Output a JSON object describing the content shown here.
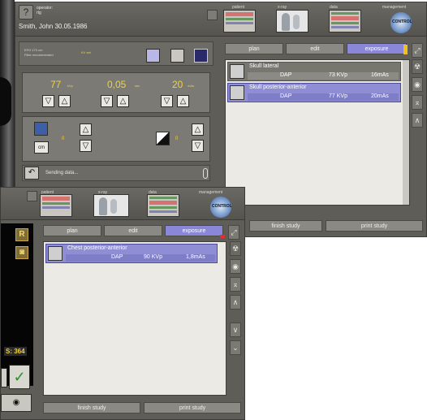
{
  "header": {
    "operator_label": "operator:",
    "operator_name": "rtg",
    "patient_name": "Smith,  John  30.05.1986",
    "sections": {
      "patient": "patient",
      "xray": "x-ray",
      "data": "data",
      "management": "management"
    },
    "logo_text": "CONTROL"
  },
  "status_panel": {
    "line1": "EFG      170 cm",
    "line2": "Filter recommended",
    "kv_set": "KV set"
  },
  "exposure": {
    "kvp_value": "77",
    "kvp_unit": "kVp",
    "mas_value": "0,05",
    "mas_unit": "sec",
    "ma_value": "20",
    "ma_unit": "mAs"
  },
  "position": {
    "cm_label": "cm",
    "height_value": "0",
    "tilt_value": "0"
  },
  "footer_status": "Sending data...",
  "tabs": [
    "plan",
    "edit",
    "exposure"
  ],
  "back_sequence": [
    {
      "name": "Skull lateral",
      "dose": "DAP",
      "kv": "73 KVp",
      "mas": "16mAs",
      "active": false
    },
    {
      "name": "Skull posterior-anterior",
      "dose": "DAP",
      "kv": "77 KVp",
      "mas": "20mAs",
      "active": true
    }
  ],
  "front_sequence": [
    {
      "name": "Chest posterior-anterior",
      "dose": "DAP",
      "kv": "90 KVp",
      "mas": "1,8mAs",
      "active": true
    }
  ],
  "buttons": {
    "finish_study": "finish study",
    "print_study": "print study"
  },
  "front_left": {
    "r_label": "R",
    "s_label": "S: 364"
  },
  "colors": {
    "accent": "#8a87d8",
    "value_yellow": "#f2d23a",
    "panel": "#5e5d58"
  }
}
